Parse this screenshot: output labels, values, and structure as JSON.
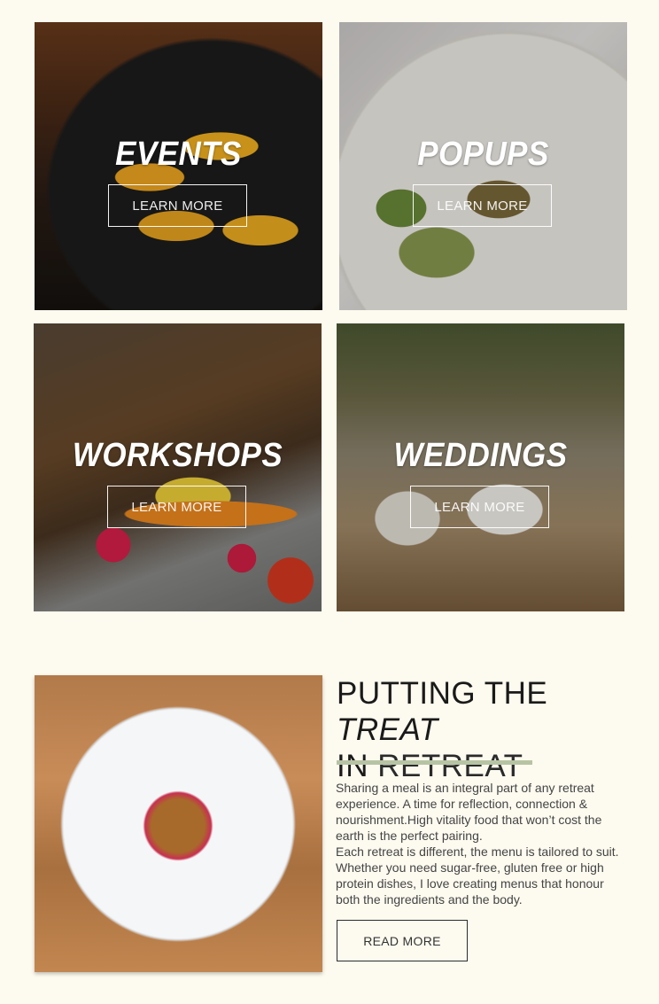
{
  "tiles": [
    {
      "title": "EVENTS",
      "button": "LEARN MORE"
    },
    {
      "title": "POPUPS",
      "button": "LEARN MORE"
    },
    {
      "title": "WORKSHOPS",
      "button": "LEARN MORE"
    },
    {
      "title": "WEDDINGS",
      "button": "LEARN MORE"
    }
  ],
  "feature": {
    "headline": {
      "part1": "PUTTING THE ",
      "part2": "TREAT",
      "part3": "IN",
      "part4": " RETREAT"
    },
    "paragraph1": "Sharing a meal is an integral part of any retreat experience. A time for reflection, connection & nourishment.High vitality food that won’t cost the earth is the perfect pairing.",
    "paragraph2": "Each retreat is different, the menu is tailored to suit. Whether you need sugar-free, gluten free or high protein dishes, I love creating menus that honour both the ingredients and the body.",
    "button": "READ MORE"
  },
  "colors": {
    "background": "#fdfaef",
    "accent_bar": "#b7c4a4",
    "text": "#1a1a1a"
  }
}
